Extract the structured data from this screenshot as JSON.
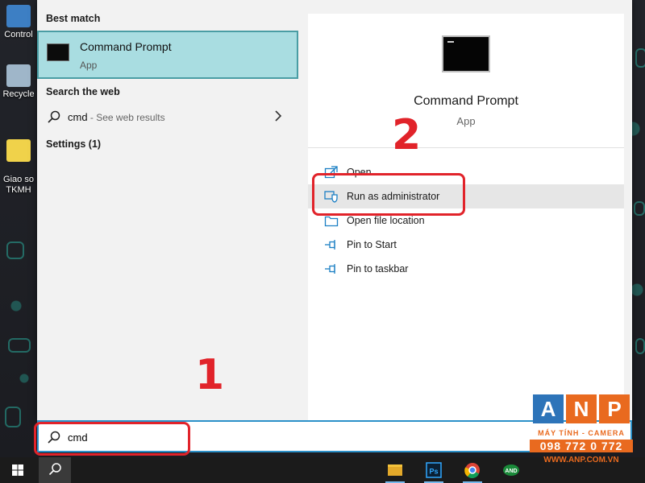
{
  "desktop": {
    "icons": [
      {
        "label": "Control",
        "color": "#3d7fc4"
      },
      {
        "label": "Recycle",
        "color": "#9fb6c9"
      },
      {
        "label": "Giao so\nTKMH",
        "color": "#f0d24a"
      }
    ]
  },
  "left_pane": {
    "best_match_header": "Best match",
    "best_match": {
      "title": "Command Prompt",
      "subtitle": "App",
      "icon": "cmd-icon"
    },
    "search_web_header": "Search the web",
    "web_result": {
      "query": "cmd",
      "hint": " - See web results",
      "icon": "search-icon"
    },
    "settings_header": "Settings (1)"
  },
  "right_pane": {
    "title": "Command Prompt",
    "subtitle": "App",
    "actions": [
      {
        "label": "Open",
        "icon": "open-icon"
      },
      {
        "label": "Run as administrator",
        "icon": "shield-icon"
      },
      {
        "label": "Open file location",
        "icon": "folder-icon"
      },
      {
        "label": "Pin to Start",
        "icon": "pin-icon"
      },
      {
        "label": "Pin to taskbar",
        "icon": "pin-icon"
      }
    ]
  },
  "search": {
    "value": "cmd",
    "icon": "search-icon"
  },
  "annotations": {
    "step1": "1",
    "step2": "2",
    "color": "#e1232a"
  },
  "watermark": {
    "letters": [
      "A",
      "N",
      "P"
    ],
    "tagline": "MÁY TÍNH - CAMERA",
    "phone": "098 772 0 772",
    "website": "WWW.ANP.COM.VN"
  },
  "taskbar": {
    "items": [
      "windows-start-icon",
      "search-icon",
      "file-explorer-icon",
      "photoshop-icon",
      "chrome-icon",
      "anp-icon"
    ]
  },
  "colors": {
    "accent": "#2b90c9",
    "best_match_bg": "#a9dde1",
    "best_match_border": "#4a9da4",
    "hover_bg": "#e6e6e6"
  }
}
